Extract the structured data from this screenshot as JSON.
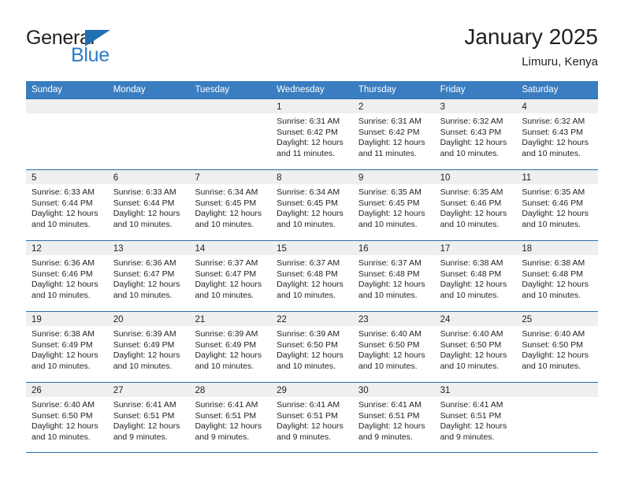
{
  "brand": {
    "name_top": "General",
    "name_bottom": "Blue",
    "accent_color": "#2a7cc7",
    "flag_color": "#1f6fb5"
  },
  "header": {
    "title": "January 2025",
    "location": "Limuru, Kenya"
  },
  "calendar": {
    "header_bg": "#3a7dc0",
    "daynum_bg": "#efefef",
    "border_color": "#2f6ca8",
    "weekday_headers": [
      "Sunday",
      "Monday",
      "Tuesday",
      "Wednesday",
      "Thursday",
      "Friday",
      "Saturday"
    ],
    "weeks": [
      [
        {
          "day": "",
          "sunrise": "",
          "sunset": "",
          "daylight_1": "",
          "daylight_2": ""
        },
        {
          "day": "",
          "sunrise": "",
          "sunset": "",
          "daylight_1": "",
          "daylight_2": ""
        },
        {
          "day": "",
          "sunrise": "",
          "sunset": "",
          "daylight_1": "",
          "daylight_2": ""
        },
        {
          "day": "1",
          "sunrise": "Sunrise: 6:31 AM",
          "sunset": "Sunset: 6:42 PM",
          "daylight_1": "Daylight: 12 hours",
          "daylight_2": "and 11 minutes."
        },
        {
          "day": "2",
          "sunrise": "Sunrise: 6:31 AM",
          "sunset": "Sunset: 6:42 PM",
          "daylight_1": "Daylight: 12 hours",
          "daylight_2": "and 11 minutes."
        },
        {
          "day": "3",
          "sunrise": "Sunrise: 6:32 AM",
          "sunset": "Sunset: 6:43 PM",
          "daylight_1": "Daylight: 12 hours",
          "daylight_2": "and 10 minutes."
        },
        {
          "day": "4",
          "sunrise": "Sunrise: 6:32 AM",
          "sunset": "Sunset: 6:43 PM",
          "daylight_1": "Daylight: 12 hours",
          "daylight_2": "and 10 minutes."
        }
      ],
      [
        {
          "day": "5",
          "sunrise": "Sunrise: 6:33 AM",
          "sunset": "Sunset: 6:44 PM",
          "daylight_1": "Daylight: 12 hours",
          "daylight_2": "and 10 minutes."
        },
        {
          "day": "6",
          "sunrise": "Sunrise: 6:33 AM",
          "sunset": "Sunset: 6:44 PM",
          "daylight_1": "Daylight: 12 hours",
          "daylight_2": "and 10 minutes."
        },
        {
          "day": "7",
          "sunrise": "Sunrise: 6:34 AM",
          "sunset": "Sunset: 6:45 PM",
          "daylight_1": "Daylight: 12 hours",
          "daylight_2": "and 10 minutes."
        },
        {
          "day": "8",
          "sunrise": "Sunrise: 6:34 AM",
          "sunset": "Sunset: 6:45 PM",
          "daylight_1": "Daylight: 12 hours",
          "daylight_2": "and 10 minutes."
        },
        {
          "day": "9",
          "sunrise": "Sunrise: 6:35 AM",
          "sunset": "Sunset: 6:45 PM",
          "daylight_1": "Daylight: 12 hours",
          "daylight_2": "and 10 minutes."
        },
        {
          "day": "10",
          "sunrise": "Sunrise: 6:35 AM",
          "sunset": "Sunset: 6:46 PM",
          "daylight_1": "Daylight: 12 hours",
          "daylight_2": "and 10 minutes."
        },
        {
          "day": "11",
          "sunrise": "Sunrise: 6:35 AM",
          "sunset": "Sunset: 6:46 PM",
          "daylight_1": "Daylight: 12 hours",
          "daylight_2": "and 10 minutes."
        }
      ],
      [
        {
          "day": "12",
          "sunrise": "Sunrise: 6:36 AM",
          "sunset": "Sunset: 6:46 PM",
          "daylight_1": "Daylight: 12 hours",
          "daylight_2": "and 10 minutes."
        },
        {
          "day": "13",
          "sunrise": "Sunrise: 6:36 AM",
          "sunset": "Sunset: 6:47 PM",
          "daylight_1": "Daylight: 12 hours",
          "daylight_2": "and 10 minutes."
        },
        {
          "day": "14",
          "sunrise": "Sunrise: 6:37 AM",
          "sunset": "Sunset: 6:47 PM",
          "daylight_1": "Daylight: 12 hours",
          "daylight_2": "and 10 minutes."
        },
        {
          "day": "15",
          "sunrise": "Sunrise: 6:37 AM",
          "sunset": "Sunset: 6:48 PM",
          "daylight_1": "Daylight: 12 hours",
          "daylight_2": "and 10 minutes."
        },
        {
          "day": "16",
          "sunrise": "Sunrise: 6:37 AM",
          "sunset": "Sunset: 6:48 PM",
          "daylight_1": "Daylight: 12 hours",
          "daylight_2": "and 10 minutes."
        },
        {
          "day": "17",
          "sunrise": "Sunrise: 6:38 AM",
          "sunset": "Sunset: 6:48 PM",
          "daylight_1": "Daylight: 12 hours",
          "daylight_2": "and 10 minutes."
        },
        {
          "day": "18",
          "sunrise": "Sunrise: 6:38 AM",
          "sunset": "Sunset: 6:48 PM",
          "daylight_1": "Daylight: 12 hours",
          "daylight_2": "and 10 minutes."
        }
      ],
      [
        {
          "day": "19",
          "sunrise": "Sunrise: 6:38 AM",
          "sunset": "Sunset: 6:49 PM",
          "daylight_1": "Daylight: 12 hours",
          "daylight_2": "and 10 minutes."
        },
        {
          "day": "20",
          "sunrise": "Sunrise: 6:39 AM",
          "sunset": "Sunset: 6:49 PM",
          "daylight_1": "Daylight: 12 hours",
          "daylight_2": "and 10 minutes."
        },
        {
          "day": "21",
          "sunrise": "Sunrise: 6:39 AM",
          "sunset": "Sunset: 6:49 PM",
          "daylight_1": "Daylight: 12 hours",
          "daylight_2": "and 10 minutes."
        },
        {
          "day": "22",
          "sunrise": "Sunrise: 6:39 AM",
          "sunset": "Sunset: 6:50 PM",
          "daylight_1": "Daylight: 12 hours",
          "daylight_2": "and 10 minutes."
        },
        {
          "day": "23",
          "sunrise": "Sunrise: 6:40 AM",
          "sunset": "Sunset: 6:50 PM",
          "daylight_1": "Daylight: 12 hours",
          "daylight_2": "and 10 minutes."
        },
        {
          "day": "24",
          "sunrise": "Sunrise: 6:40 AM",
          "sunset": "Sunset: 6:50 PM",
          "daylight_1": "Daylight: 12 hours",
          "daylight_2": "and 10 minutes."
        },
        {
          "day": "25",
          "sunrise": "Sunrise: 6:40 AM",
          "sunset": "Sunset: 6:50 PM",
          "daylight_1": "Daylight: 12 hours",
          "daylight_2": "and 10 minutes."
        }
      ],
      [
        {
          "day": "26",
          "sunrise": "Sunrise: 6:40 AM",
          "sunset": "Sunset: 6:50 PM",
          "daylight_1": "Daylight: 12 hours",
          "daylight_2": "and 10 minutes."
        },
        {
          "day": "27",
          "sunrise": "Sunrise: 6:41 AM",
          "sunset": "Sunset: 6:51 PM",
          "daylight_1": "Daylight: 12 hours",
          "daylight_2": "and 9 minutes."
        },
        {
          "day": "28",
          "sunrise": "Sunrise: 6:41 AM",
          "sunset": "Sunset: 6:51 PM",
          "daylight_1": "Daylight: 12 hours",
          "daylight_2": "and 9 minutes."
        },
        {
          "day": "29",
          "sunrise": "Sunrise: 6:41 AM",
          "sunset": "Sunset: 6:51 PM",
          "daylight_1": "Daylight: 12 hours",
          "daylight_2": "and 9 minutes."
        },
        {
          "day": "30",
          "sunrise": "Sunrise: 6:41 AM",
          "sunset": "Sunset: 6:51 PM",
          "daylight_1": "Daylight: 12 hours",
          "daylight_2": "and 9 minutes."
        },
        {
          "day": "31",
          "sunrise": "Sunrise: 6:41 AM",
          "sunset": "Sunset: 6:51 PM",
          "daylight_1": "Daylight: 12 hours",
          "daylight_2": "and 9 minutes."
        },
        {
          "day": "",
          "sunrise": "",
          "sunset": "",
          "daylight_1": "",
          "daylight_2": ""
        }
      ]
    ]
  }
}
